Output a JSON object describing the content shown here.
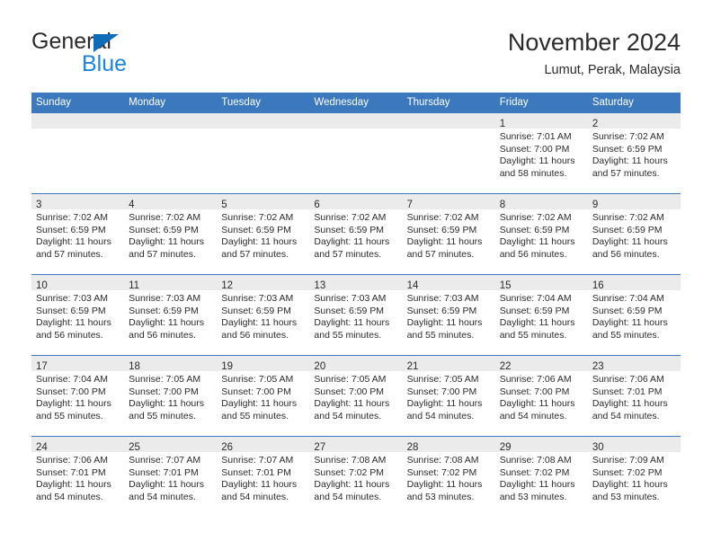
{
  "brand": {
    "word_general": "General",
    "word_blue": "Blue",
    "flag_icon": "triangle-flag-icon",
    "accent_color": "#1d84d6",
    "flag_color": "#0f6cb8"
  },
  "header": {
    "title": "November 2024",
    "subtitle": "Lumut, Perak, Malaysia"
  },
  "theme": {
    "header_blue": "#3c78bd",
    "daynum_band_gray": "#ebebeb",
    "text_color": "#2b2b2b"
  },
  "weekday_headers": [
    "Sunday",
    "Monday",
    "Tuesday",
    "Wednesday",
    "Thursday",
    "Friday",
    "Saturday"
  ],
  "weeks": [
    [
      {
        "empty": true,
        "day": ""
      },
      {
        "empty": true,
        "day": ""
      },
      {
        "empty": true,
        "day": ""
      },
      {
        "empty": true,
        "day": ""
      },
      {
        "empty": true,
        "day": ""
      },
      {
        "empty": false,
        "day": "1",
        "sunrise": "Sunrise: 7:01 AM",
        "sunset": "Sunset: 7:00 PM",
        "daylight_line1": "Daylight: 11 hours",
        "daylight_line2": "and 58 minutes."
      },
      {
        "empty": false,
        "day": "2",
        "sunrise": "Sunrise: 7:02 AM",
        "sunset": "Sunset: 6:59 PM",
        "daylight_line1": "Daylight: 11 hours",
        "daylight_line2": "and 57 minutes."
      }
    ],
    [
      {
        "empty": false,
        "day": "3",
        "sunrise": "Sunrise: 7:02 AM",
        "sunset": "Sunset: 6:59 PM",
        "daylight_line1": "Daylight: 11 hours",
        "daylight_line2": "and 57 minutes."
      },
      {
        "empty": false,
        "day": "4",
        "sunrise": "Sunrise: 7:02 AM",
        "sunset": "Sunset: 6:59 PM",
        "daylight_line1": "Daylight: 11 hours",
        "daylight_line2": "and 57 minutes."
      },
      {
        "empty": false,
        "day": "5",
        "sunrise": "Sunrise: 7:02 AM",
        "sunset": "Sunset: 6:59 PM",
        "daylight_line1": "Daylight: 11 hours",
        "daylight_line2": "and 57 minutes."
      },
      {
        "empty": false,
        "day": "6",
        "sunrise": "Sunrise: 7:02 AM",
        "sunset": "Sunset: 6:59 PM",
        "daylight_line1": "Daylight: 11 hours",
        "daylight_line2": "and 57 minutes."
      },
      {
        "empty": false,
        "day": "7",
        "sunrise": "Sunrise: 7:02 AM",
        "sunset": "Sunset: 6:59 PM",
        "daylight_line1": "Daylight: 11 hours",
        "daylight_line2": "and 57 minutes."
      },
      {
        "empty": false,
        "day": "8",
        "sunrise": "Sunrise: 7:02 AM",
        "sunset": "Sunset: 6:59 PM",
        "daylight_line1": "Daylight: 11 hours",
        "daylight_line2": "and 56 minutes."
      },
      {
        "empty": false,
        "day": "9",
        "sunrise": "Sunrise: 7:02 AM",
        "sunset": "Sunset: 6:59 PM",
        "daylight_line1": "Daylight: 11 hours",
        "daylight_line2": "and 56 minutes."
      }
    ],
    [
      {
        "empty": false,
        "day": "10",
        "sunrise": "Sunrise: 7:03 AM",
        "sunset": "Sunset: 6:59 PM",
        "daylight_line1": "Daylight: 11 hours",
        "daylight_line2": "and 56 minutes."
      },
      {
        "empty": false,
        "day": "11",
        "sunrise": "Sunrise: 7:03 AM",
        "sunset": "Sunset: 6:59 PM",
        "daylight_line1": "Daylight: 11 hours",
        "daylight_line2": "and 56 minutes."
      },
      {
        "empty": false,
        "day": "12",
        "sunrise": "Sunrise: 7:03 AM",
        "sunset": "Sunset: 6:59 PM",
        "daylight_line1": "Daylight: 11 hours",
        "daylight_line2": "and 56 minutes."
      },
      {
        "empty": false,
        "day": "13",
        "sunrise": "Sunrise: 7:03 AM",
        "sunset": "Sunset: 6:59 PM",
        "daylight_line1": "Daylight: 11 hours",
        "daylight_line2": "and 55 minutes."
      },
      {
        "empty": false,
        "day": "14",
        "sunrise": "Sunrise: 7:03 AM",
        "sunset": "Sunset: 6:59 PM",
        "daylight_line1": "Daylight: 11 hours",
        "daylight_line2": "and 55 minutes."
      },
      {
        "empty": false,
        "day": "15",
        "sunrise": "Sunrise: 7:04 AM",
        "sunset": "Sunset: 6:59 PM",
        "daylight_line1": "Daylight: 11 hours",
        "daylight_line2": "and 55 minutes."
      },
      {
        "empty": false,
        "day": "16",
        "sunrise": "Sunrise: 7:04 AM",
        "sunset": "Sunset: 6:59 PM",
        "daylight_line1": "Daylight: 11 hours",
        "daylight_line2": "and 55 minutes."
      }
    ],
    [
      {
        "empty": false,
        "day": "17",
        "sunrise": "Sunrise: 7:04 AM",
        "sunset": "Sunset: 7:00 PM",
        "daylight_line1": "Daylight: 11 hours",
        "daylight_line2": "and 55 minutes."
      },
      {
        "empty": false,
        "day": "18",
        "sunrise": "Sunrise: 7:05 AM",
        "sunset": "Sunset: 7:00 PM",
        "daylight_line1": "Daylight: 11 hours",
        "daylight_line2": "and 55 minutes."
      },
      {
        "empty": false,
        "day": "19",
        "sunrise": "Sunrise: 7:05 AM",
        "sunset": "Sunset: 7:00 PM",
        "daylight_line1": "Daylight: 11 hours",
        "daylight_line2": "and 55 minutes."
      },
      {
        "empty": false,
        "day": "20",
        "sunrise": "Sunrise: 7:05 AM",
        "sunset": "Sunset: 7:00 PM",
        "daylight_line1": "Daylight: 11 hours",
        "daylight_line2": "and 54 minutes."
      },
      {
        "empty": false,
        "day": "21",
        "sunrise": "Sunrise: 7:05 AM",
        "sunset": "Sunset: 7:00 PM",
        "daylight_line1": "Daylight: 11 hours",
        "daylight_line2": "and 54 minutes."
      },
      {
        "empty": false,
        "day": "22",
        "sunrise": "Sunrise: 7:06 AM",
        "sunset": "Sunset: 7:00 PM",
        "daylight_line1": "Daylight: 11 hours",
        "daylight_line2": "and 54 minutes."
      },
      {
        "empty": false,
        "day": "23",
        "sunrise": "Sunrise: 7:06 AM",
        "sunset": "Sunset: 7:01 PM",
        "daylight_line1": "Daylight: 11 hours",
        "daylight_line2": "and 54 minutes."
      }
    ],
    [
      {
        "empty": false,
        "day": "24",
        "sunrise": "Sunrise: 7:06 AM",
        "sunset": "Sunset: 7:01 PM",
        "daylight_line1": "Daylight: 11 hours",
        "daylight_line2": "and 54 minutes."
      },
      {
        "empty": false,
        "day": "25",
        "sunrise": "Sunrise: 7:07 AM",
        "sunset": "Sunset: 7:01 PM",
        "daylight_line1": "Daylight: 11 hours",
        "daylight_line2": "and 54 minutes."
      },
      {
        "empty": false,
        "day": "26",
        "sunrise": "Sunrise: 7:07 AM",
        "sunset": "Sunset: 7:01 PM",
        "daylight_line1": "Daylight: 11 hours",
        "daylight_line2": "and 54 minutes."
      },
      {
        "empty": false,
        "day": "27",
        "sunrise": "Sunrise: 7:08 AM",
        "sunset": "Sunset: 7:02 PM",
        "daylight_line1": "Daylight: 11 hours",
        "daylight_line2": "and 54 minutes."
      },
      {
        "empty": false,
        "day": "28",
        "sunrise": "Sunrise: 7:08 AM",
        "sunset": "Sunset: 7:02 PM",
        "daylight_line1": "Daylight: 11 hours",
        "daylight_line2": "and 53 minutes."
      },
      {
        "empty": false,
        "day": "29",
        "sunrise": "Sunrise: 7:08 AM",
        "sunset": "Sunset: 7:02 PM",
        "daylight_line1": "Daylight: 11 hours",
        "daylight_line2": "and 53 minutes."
      },
      {
        "empty": false,
        "day": "30",
        "sunrise": "Sunrise: 7:09 AM",
        "sunset": "Sunset: 7:02 PM",
        "daylight_line1": "Daylight: 11 hours",
        "daylight_line2": "and 53 minutes."
      }
    ]
  ]
}
